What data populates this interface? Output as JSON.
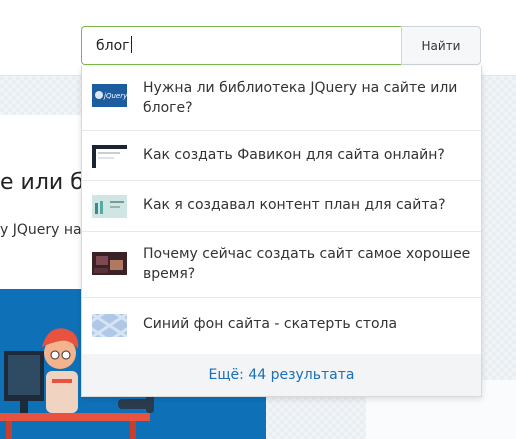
{
  "search": {
    "query": "блог",
    "button_label": "Найти"
  },
  "results": [
    {
      "title": "Нужна ли библиотека JQuery на сайте или блоге?",
      "thumb_text": "jQuery",
      "thumb_icon": "jquery-logo-thumbnail"
    },
    {
      "title": "Как создать Фавикон для сайта онлайн?",
      "thumb_icon": "favicon-site-thumbnail"
    },
    {
      "title": "Как я создавал контент план для сайта?",
      "thumb_icon": "content-plan-thumbnail"
    },
    {
      "title": "Почему сейчас создать сайт самое хорошее время?",
      "thumb_icon": "website-photo-thumbnail"
    },
    {
      "title": "Синий фон сайта - скатерть стола",
      "thumb_icon": "blue-tablecloth-thumbnail"
    }
  ],
  "more_results_label": "Ещё: 44 результата",
  "background_article": {
    "title_fragment": "е или бл",
    "subtitle_fragment": "у JQuery на"
  },
  "colors": {
    "input_border": "#7bb94a",
    "link_blue": "#1a6fb5",
    "article_image_blue": "#0e71b8"
  }
}
